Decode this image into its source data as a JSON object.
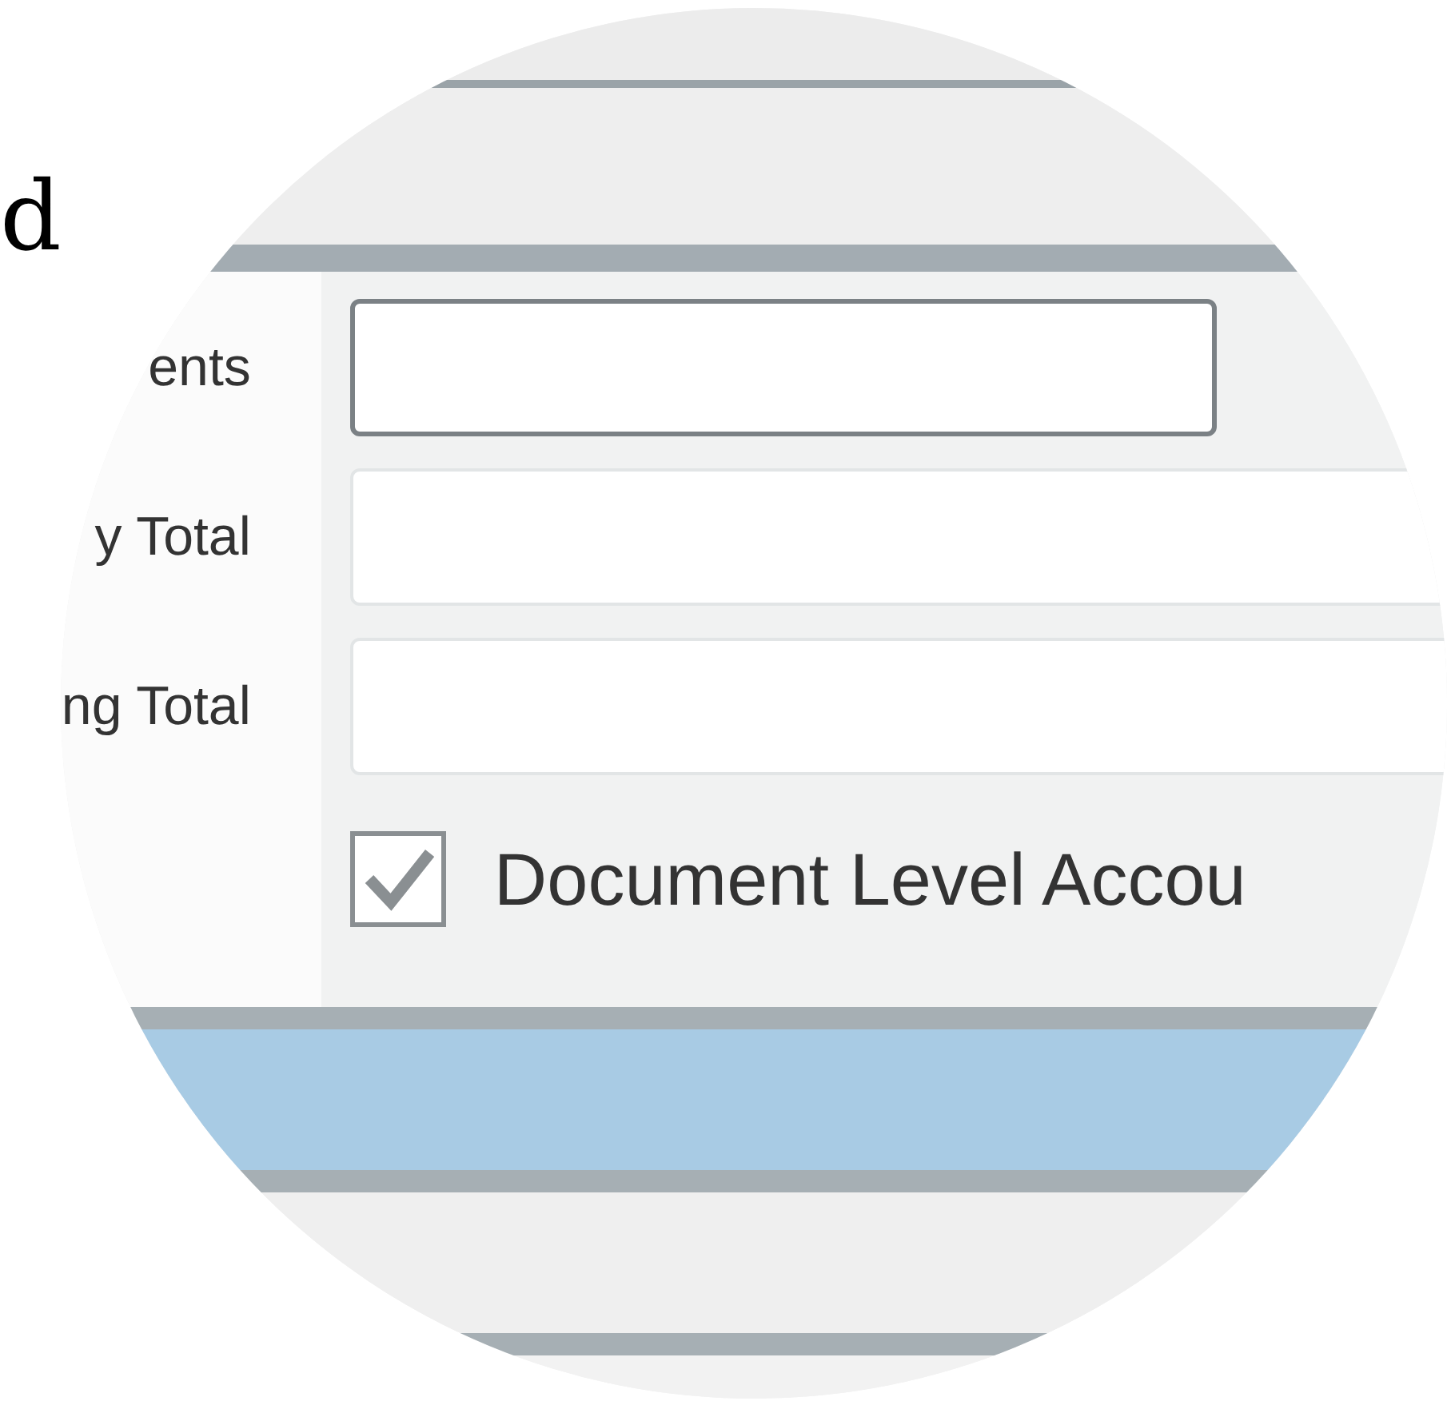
{
  "heading": {
    "text": "d"
  },
  "form": {
    "rows": [
      {
        "label": "ents",
        "focused": true
      },
      {
        "label": "y Total",
        "focused": false
      },
      {
        "label": "ng Total",
        "focused": false
      }
    ],
    "checkbox": {
      "label": "Document Level Accou",
      "checked": true
    }
  }
}
